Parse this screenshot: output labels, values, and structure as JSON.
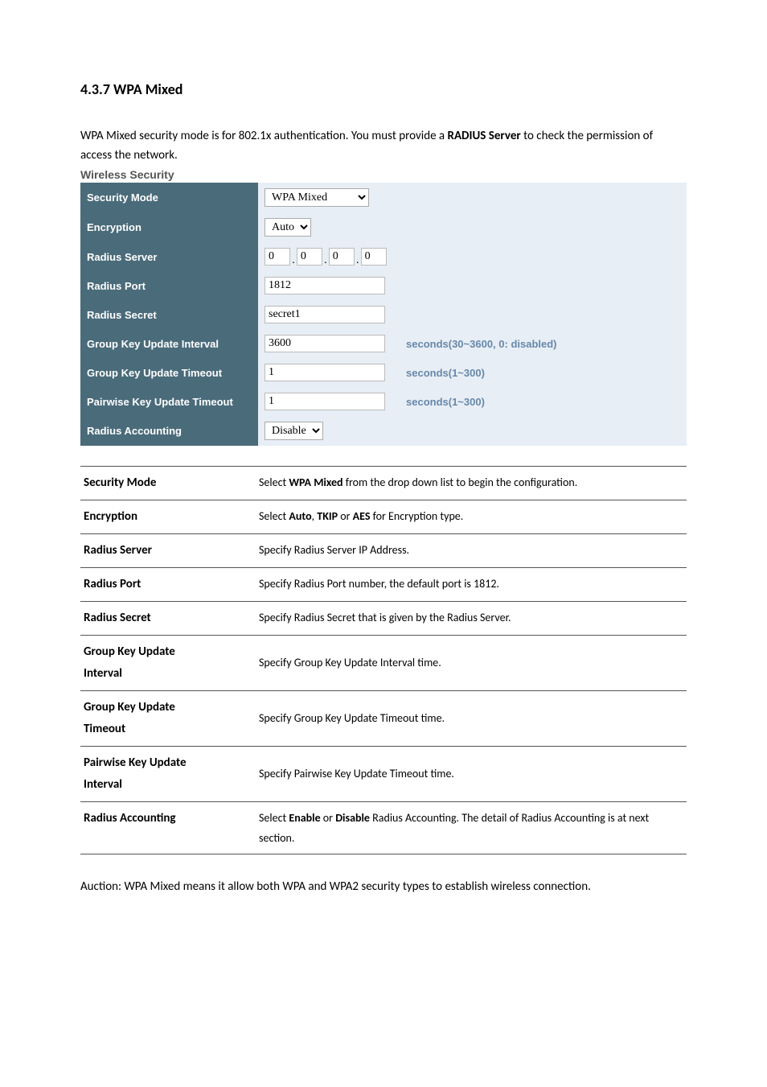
{
  "heading": "4.3.7 WPA Mixed",
  "intro_part1": "WPA Mixed security mode is for 802.1x authentication. You must provide a ",
  "intro_bold": "RADIUS Server",
  "intro_part2": " to check the permission of access the network.",
  "section_title": "Wireless Security",
  "config": {
    "security_mode_label": "Security Mode",
    "security_mode_value": "WPA Mixed",
    "encryption_label": "Encryption",
    "encryption_value": "Auto",
    "radius_server_label": "Radius Server",
    "radius_server_ip": [
      "0",
      "0",
      "0",
      "0"
    ],
    "radius_port_label": "Radius Port",
    "radius_port_value": "1812",
    "radius_secret_label": "Radius Secret",
    "radius_secret_value": "secret1",
    "group_key_interval_label": "Group Key Update Interval",
    "group_key_interval_value": "3600",
    "group_key_interval_hint": "seconds(30~3600, 0: disabled)",
    "group_key_timeout_label": "Group Key Update Timeout",
    "group_key_timeout_value": "1",
    "group_key_timeout_hint": "seconds(1~300)",
    "pairwise_timeout_label": "Pairwise Key Update Timeout",
    "pairwise_timeout_value": "1",
    "pairwise_timeout_hint": "seconds(1~300)",
    "radius_accounting_label": "Radius Accounting",
    "radius_accounting_value": "Disable"
  },
  "desc": {
    "security_mode_label": "Security Mode",
    "security_mode_text1": "Select ",
    "security_mode_bold": "WPA Mixed",
    "security_mode_text2": " from the drop down list to begin the configuration.",
    "encryption_label": "Encryption",
    "encryption_text1": "Select ",
    "encryption_bold1": "Auto",
    "encryption_text2": ", ",
    "encryption_bold2": "TKIP",
    "encryption_text3": " or ",
    "encryption_bold3": "AES",
    "encryption_text4": " for Encryption type.",
    "radius_server_label": "Radius Server",
    "radius_server_text": "Specify Radius Server IP Address.",
    "radius_port_label": "Radius Port",
    "radius_port_text": "Specify Radius Port number, the default port is 1812.",
    "radius_secret_label": "Radius Secret",
    "radius_secret_text": "Specify Radius Secret that is given by the Radius Server.",
    "group_key_interval_label1": "Group Key Update",
    "group_key_interval_label2": "Interval",
    "group_key_interval_text": "Specify Group Key Update Interval time.",
    "group_key_timeout_label1": "Group Key Update",
    "group_key_timeout_label2": "Timeout",
    "group_key_timeout_text": "Specify Group Key Update Timeout time.",
    "pairwise_label1": "Pairwise Key Update",
    "pairwise_label2": "Interval",
    "pairwise_text": "Specify Pairwise Key Update Timeout time.",
    "radius_accounting_label": "Radius Accounting",
    "radius_accounting_text1": "Select ",
    "radius_accounting_bold1": "Enable",
    "radius_accounting_text2": " or ",
    "radius_accounting_bold2": "Disable",
    "radius_accounting_text3": " Radius Accounting. The detail of Radius Accounting is at next section."
  },
  "footer": "Auction: WPA Mixed means it allow both WPA and WPA2 security types to establish wireless connection."
}
